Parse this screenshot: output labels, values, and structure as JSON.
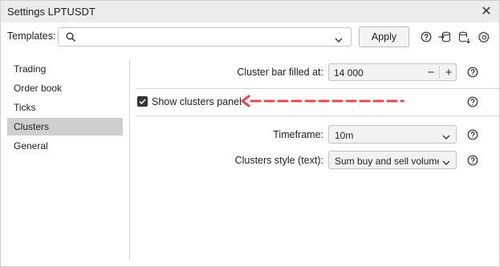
{
  "window": {
    "title": "Settings LPTUSDT",
    "close_glyph": "✕"
  },
  "toolbar": {
    "templates_label": "Templates:",
    "templates_value": "",
    "apply_label": "Apply",
    "icons": [
      "help-circle-icon",
      "import-database-icon",
      "export-database-icon",
      "gear-icon"
    ]
  },
  "sidebar": {
    "items": [
      {
        "label": "Trading"
      },
      {
        "label": "Order book"
      },
      {
        "label": "Ticks"
      },
      {
        "label": "Clusters",
        "active": true
      },
      {
        "label": "General"
      }
    ]
  },
  "main": {
    "cluster_bar": {
      "label": "Cluster bar filled at:",
      "value": "14 000",
      "minus": "−",
      "plus": "+"
    },
    "show_clusters_panel": {
      "label": "Show clusters panel",
      "checked": true
    },
    "timeframe": {
      "label": "Timeframe:",
      "value": "10m"
    },
    "clusters_style": {
      "label": "Clusters style (text):",
      "value": "Sum buy and sell volume"
    }
  },
  "annotation": {
    "arrow_color": "#e8474f"
  }
}
